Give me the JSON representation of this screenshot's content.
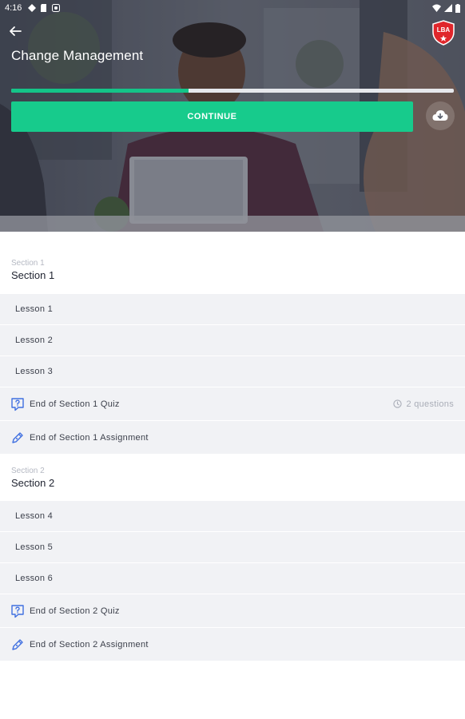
{
  "status_bar": {
    "time": "4:16"
  },
  "header": {
    "course_title": "Change Management",
    "logo_text": "LBA",
    "progress_percent": 40,
    "continue_label": "CONTINUE"
  },
  "sections": [
    {
      "kicker": "Section 1",
      "title": "Section 1",
      "lessons": [
        "Lesson 1",
        "Lesson 2",
        "Lesson 3"
      ],
      "quiz": {
        "label": "End of Section 1 Quiz",
        "meta": "2 questions"
      },
      "assignment": {
        "label": "End of Section 1 Assignment"
      }
    },
    {
      "kicker": "Section 2",
      "title": "Section 2",
      "lessons": [
        "Lesson 4",
        "Lesson 5",
        "Lesson 6"
      ],
      "quiz": {
        "label": "End of Section 2 Quiz"
      },
      "assignment": {
        "label": "End of Section 2 Assignment"
      }
    }
  ],
  "colors": {
    "accent": "#17cb8c",
    "row_bg": "#f1f2f5",
    "icon_blue": "#3f6fe0",
    "logo_red": "#e0262b"
  },
  "icons": {
    "back": "arrow-left-icon",
    "download": "cloud-download-icon",
    "quiz": "question-bubble-icon",
    "assignment": "pen-icon",
    "clock": "clock-icon"
  }
}
